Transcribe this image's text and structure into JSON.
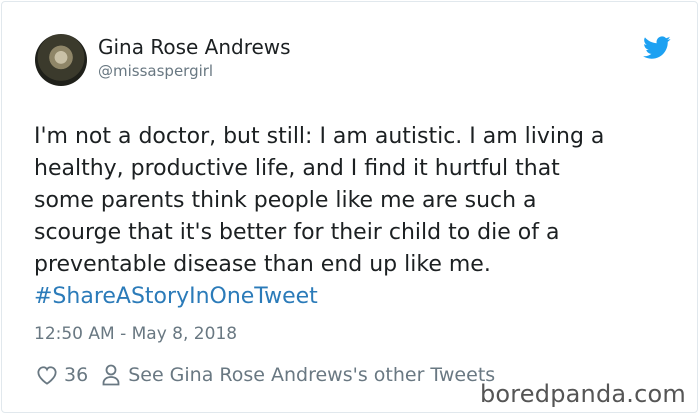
{
  "author": {
    "display_name": "Gina Rose Andrews",
    "handle": "@missaspergirl"
  },
  "tweet": {
    "lines": [
      "I'm not a doctor, but still:  I am autistic. I am living a",
      "healthy, productive life, and I find it hurtful that",
      "some parents think people like me are such a",
      "scourge that it's better for their child to die of a",
      "preventable disease than end up like me."
    ],
    "hashtag": "#ShareAStoryInOneTweet",
    "timestamp": "12:50 AM - May 8, 2018"
  },
  "actions": {
    "like_count": "36",
    "other_tweets_label": "See Gina Rose Andrews's other Tweets"
  },
  "watermark": "boredpanda.com",
  "colors": {
    "twitter_blue": "#1da1f2",
    "hashtag": "#2b7bb9",
    "text": "#1c2022",
    "muted": "#697882"
  },
  "icons": {
    "brand": "twitter-bird-icon",
    "like": "heart-icon",
    "profile": "person-icon"
  }
}
